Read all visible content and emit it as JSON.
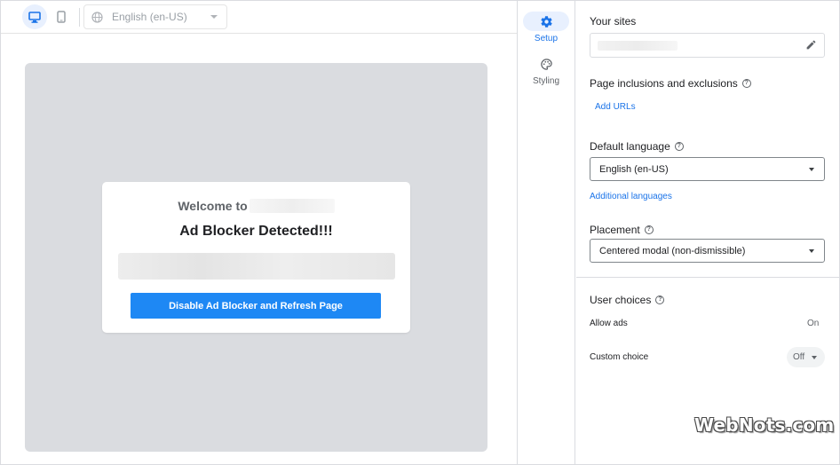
{
  "toolbar": {
    "language_value": "English (en-US)"
  },
  "preview": {
    "welcome_text": "Welcome to",
    "title": "Ad Blocker Detected!!!",
    "button_label": "Disable Ad Blocker and Refresh Page",
    "button_color": "#1e88f4"
  },
  "rail": {
    "setup_label": "Setup",
    "styling_label": "Styling",
    "active_color": "#1a73e8"
  },
  "panel": {
    "your_sites_title": "Your sites",
    "page_inclusions_title": "Page inclusions and exclusions",
    "add_urls_link": "Add URLs",
    "default_language_title": "Default language",
    "default_language_value": "English (en-US)",
    "additional_languages_link": "Additional languages",
    "placement_title": "Placement",
    "placement_value": "Centered modal (non-dismissible)",
    "user_choices_title": "User choices",
    "allow_ads_label": "Allow ads",
    "allow_ads_value": "On",
    "custom_choice_label": "Custom choice",
    "custom_choice_value": "Off"
  },
  "icons": {
    "desktop": "desktop-icon",
    "mobile": "mobile-icon",
    "globe": "globe-icon",
    "setup": "gear-icon",
    "styling": "palette-icon",
    "edit": "pencil-icon",
    "help": "help-icon"
  },
  "watermark": "WebNots.com"
}
